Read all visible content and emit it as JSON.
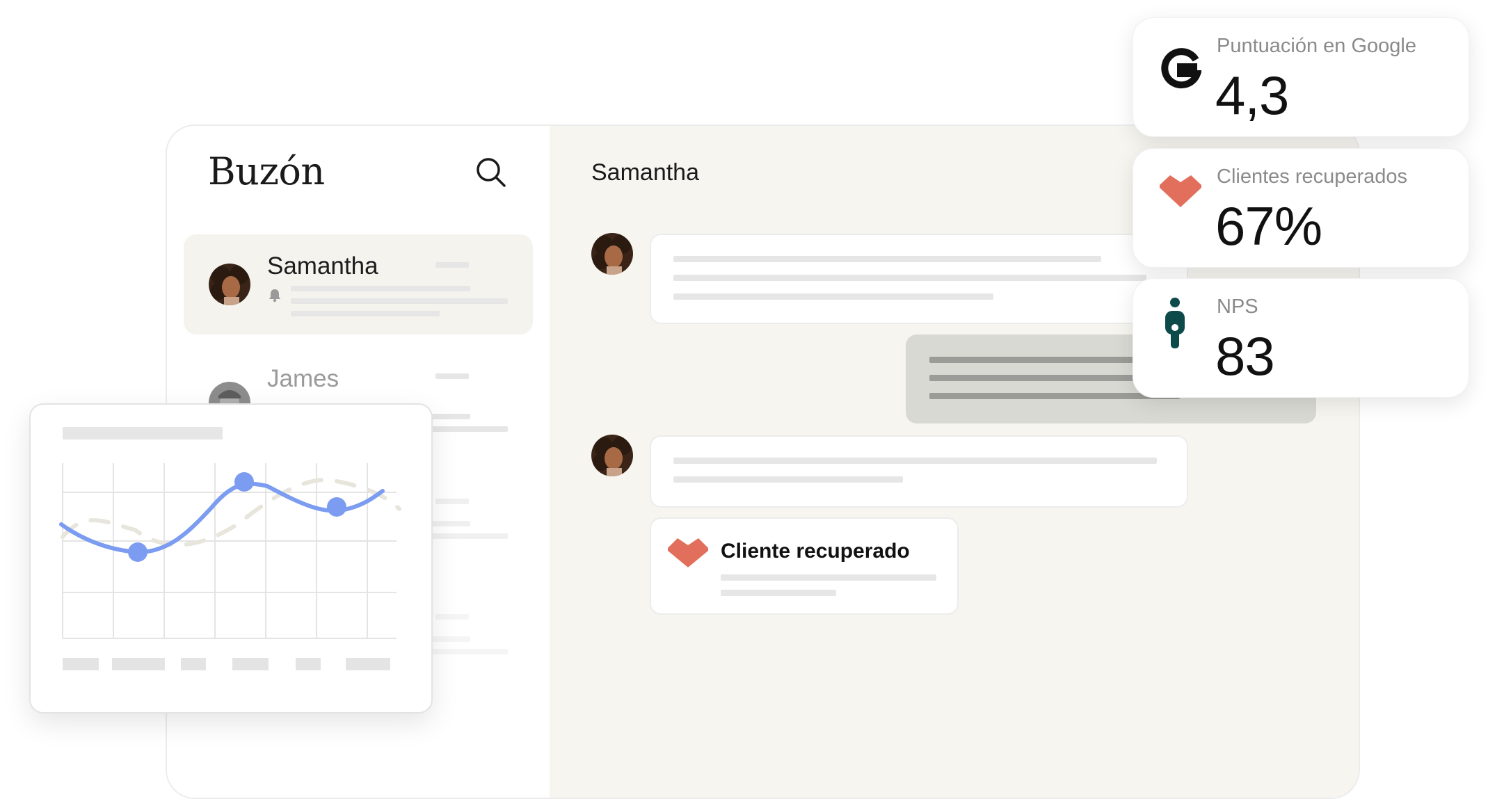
{
  "sidebar": {
    "title": "Buzón",
    "conversations": [
      {
        "name": "Samantha"
      },
      {
        "name": "James"
      }
    ]
  },
  "conversation": {
    "contact_name": "Samantha",
    "recovered_label": "Cliente recuperado"
  },
  "stats": [
    {
      "label": "Puntuación en Google",
      "value": "4,3",
      "icon": "google-g-icon"
    },
    {
      "label": "Clientes recuperados",
      "value": "67%",
      "icon": "heart-icon"
    },
    {
      "label": "NPS",
      "value": "83",
      "icon": "person-icon"
    }
  ],
  "colors": {
    "heart": "#e26f5c",
    "nps_icon": "#0d4b4b",
    "chart_line": "#7b9cf0",
    "chat_bg": "#f6f5f0"
  }
}
